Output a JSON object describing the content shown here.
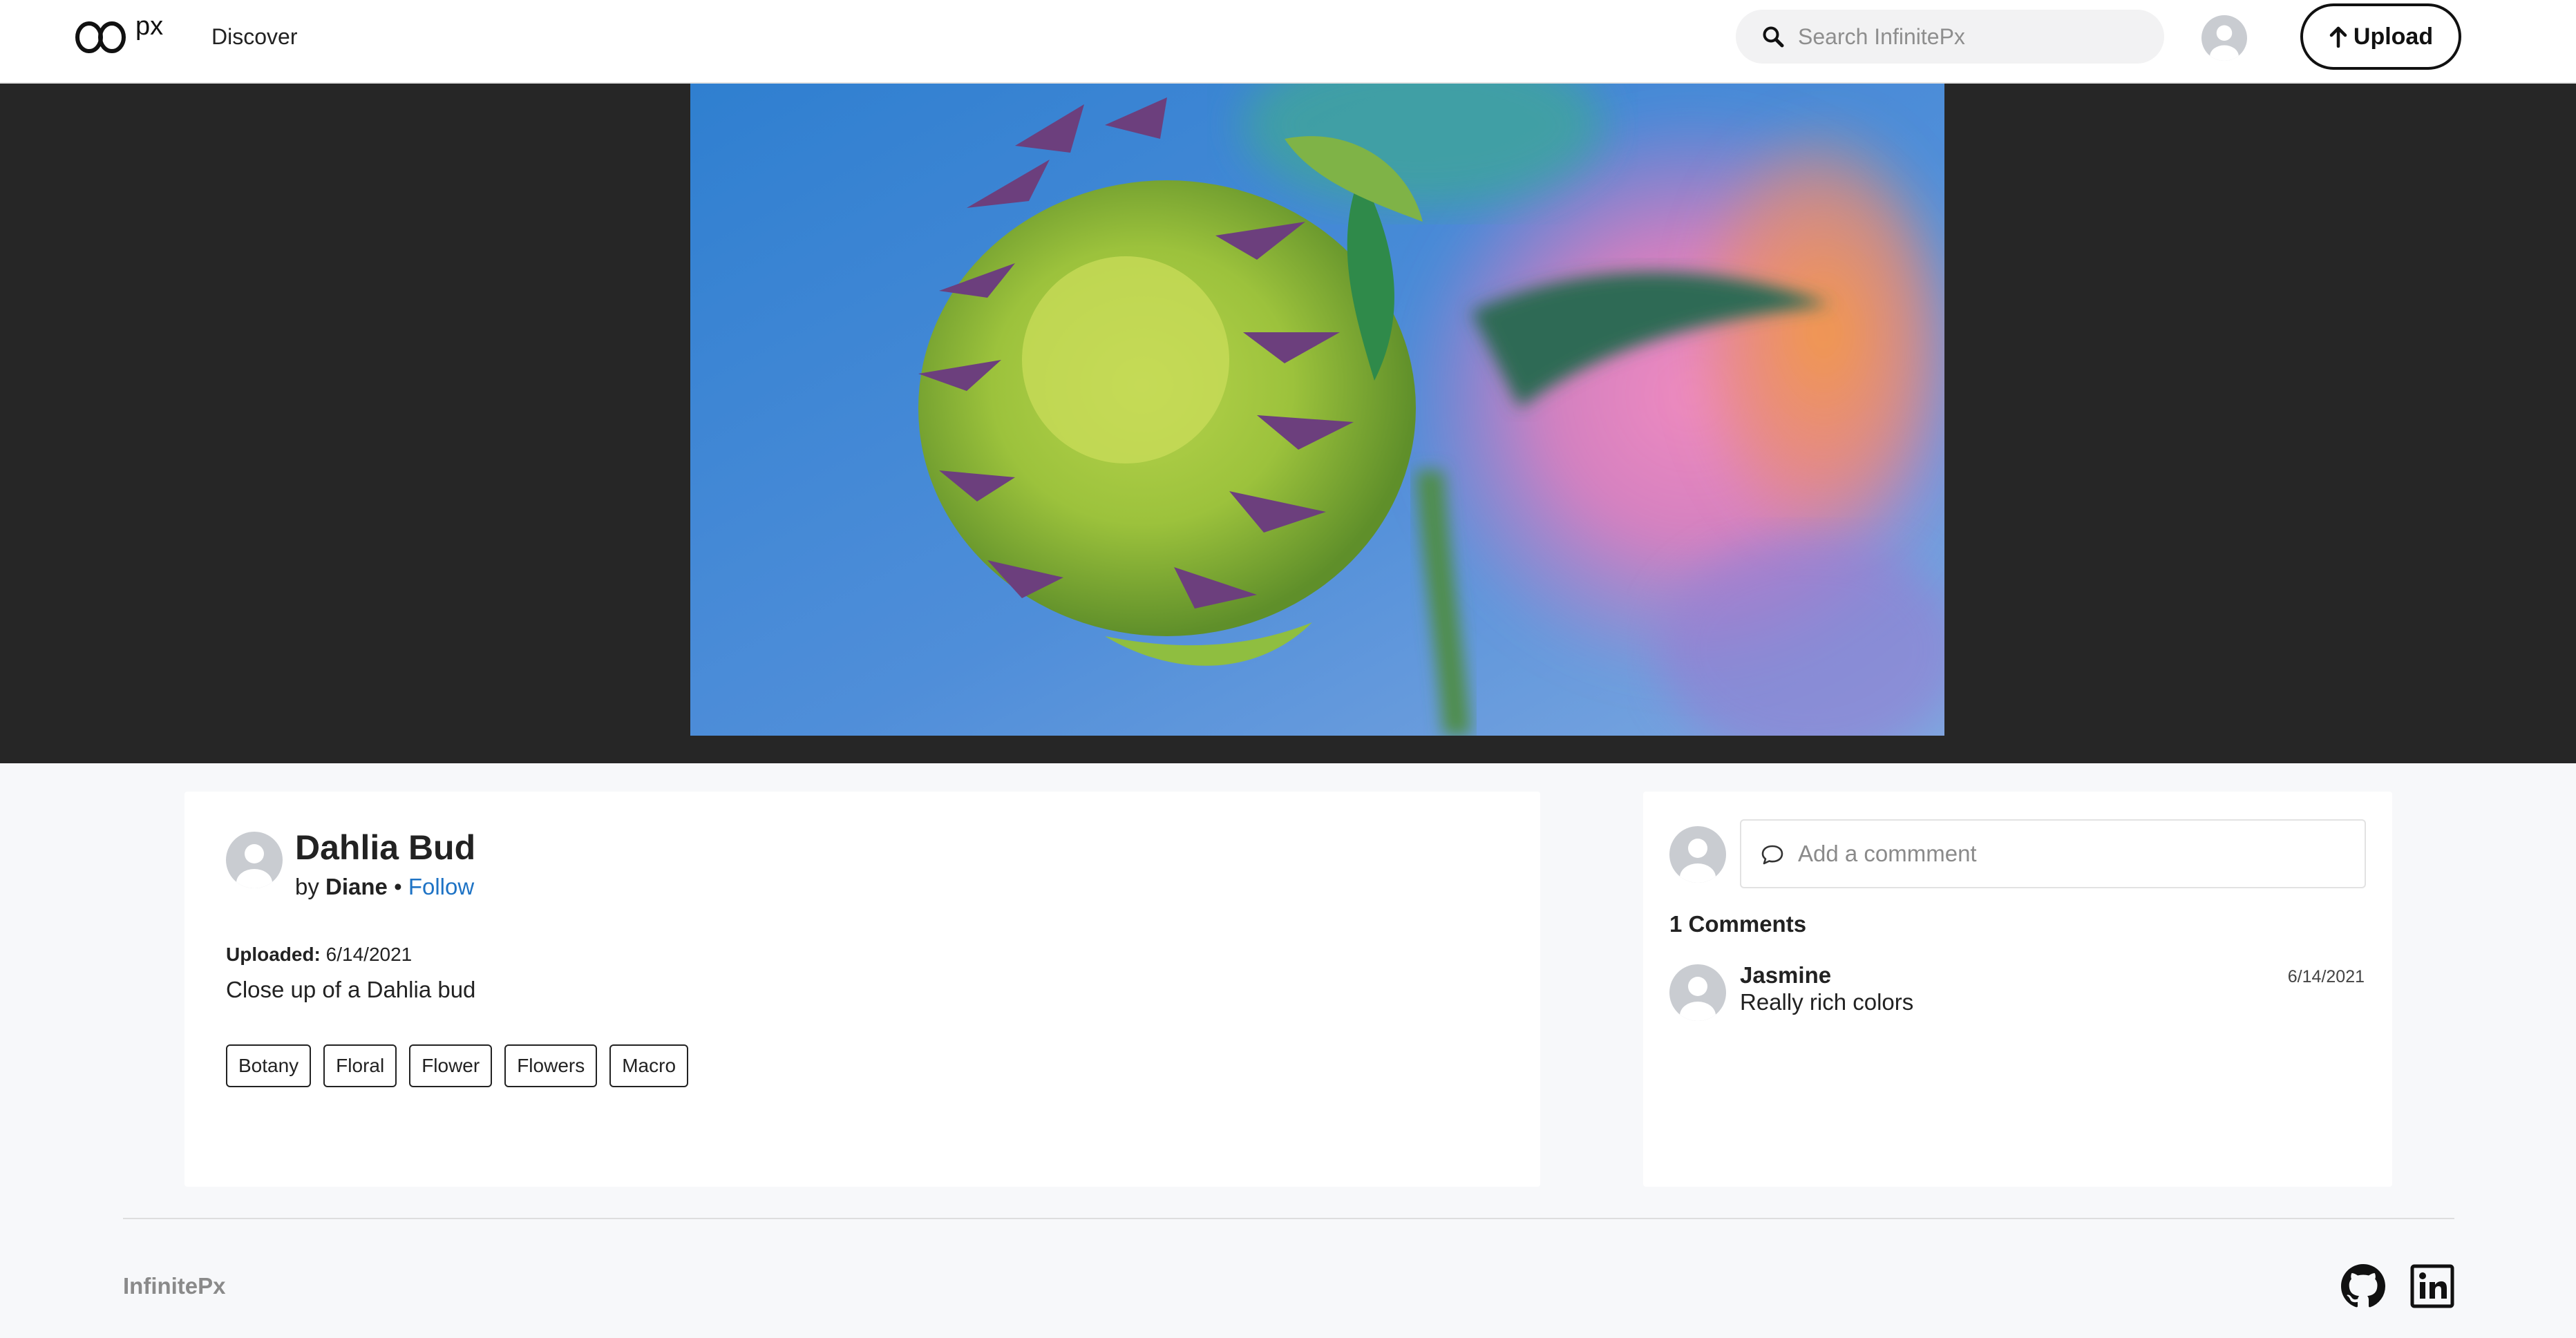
{
  "header": {
    "logo_text": "px",
    "nav": {
      "discover_label": "Discover"
    },
    "search": {
      "placeholder": "Search InfinitePx",
      "value": ""
    },
    "upload_label": "Upload"
  },
  "photo": {
    "subject": "Close-up of a green dahlia bud with purple tips against a blue and pink blurred background"
  },
  "info": {
    "title": "Dahlia Bud",
    "by_prefix": "by",
    "author": "Diane",
    "separator": "•",
    "follow_label": "Follow",
    "uploaded_label": "Uploaded:",
    "uploaded_date": "6/14/2021",
    "description": "Close up of a Dahlia bud",
    "tags": [
      "Botany",
      "Floral",
      "Flower",
      "Flowers",
      "Macro"
    ]
  },
  "comments": {
    "input_placeholder": "Add a commment",
    "count_label": "1 Comments",
    "items": [
      {
        "author": "Jasmine",
        "date": "6/14/2021",
        "text": "Really rich colors"
      }
    ]
  },
  "footer": {
    "brand": "InfinitePx",
    "icons": [
      "github-icon",
      "linkedin-icon"
    ]
  },
  "colors": {
    "link": "#1e73c5",
    "hero_background": "#262626",
    "page_background": "#f7f8fa"
  }
}
